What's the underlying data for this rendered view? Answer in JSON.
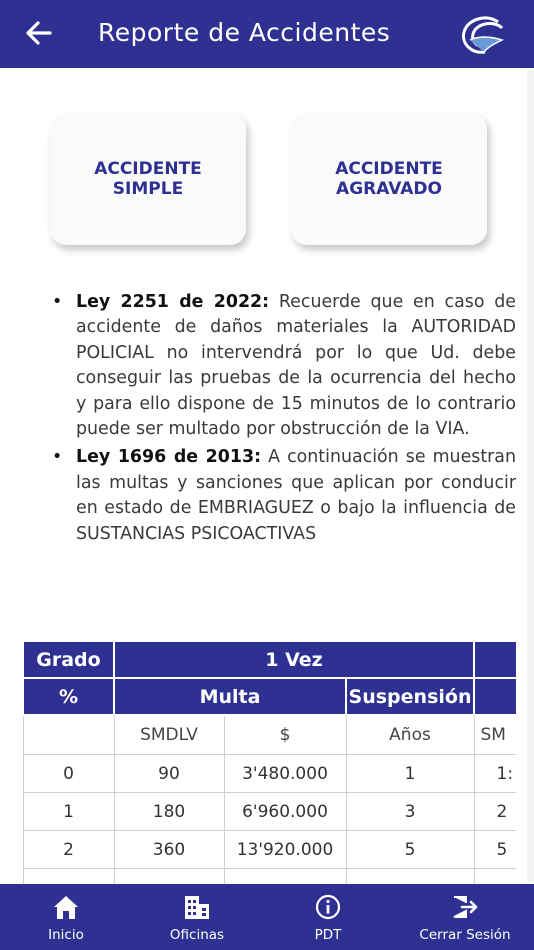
{
  "appbar": {
    "title": "Reporte de Accidentes",
    "back_icon": "arrow-left-icon",
    "logo": "brand-swirl-logo"
  },
  "cards": [
    {
      "label": "ACCIDENTE SIMPLE"
    },
    {
      "label": "ACCIDENTE AGRAVADO"
    }
  ],
  "info": [
    {
      "law": "Ley 2251 de 2022:",
      "text": " Recuerde que en caso de accidente de daños materiales la AUTORIDAD POLICIAL no intervendrá por lo que Ud. debe conseguir las pruebas de la ocurrencia del hecho y para ello dispone de 15 minutos de lo contrario puede ser multado por obstrucción de la VIA."
    },
    {
      "law": "Ley 1696 de 2013:",
      "text": " A continuación se muestran las multas y sanciones que aplican por conducir en estado de EMBRIAGUEZ o bajo la influencia de SUSTANCIAS PSICOACTIVAS"
    }
  ],
  "table": {
    "header_grado": "Grado",
    "header_vez": "1 Vez",
    "header_pct": "%",
    "header_multa": "Multa",
    "header_suspension": "Suspensión",
    "sub_smdlv": "SMDLV",
    "sub_peso": "$",
    "sub_anos": "Años",
    "sub_next": "SM",
    "rows": [
      {
        "grado": "0",
        "smdlv": "90",
        "pesos": "3'480.000",
        "anos": "1",
        "next": "1:"
      },
      {
        "grado": "1",
        "smdlv": "180",
        "pesos": "6'960.000",
        "anos": "3",
        "next": "2"
      },
      {
        "grado": "2",
        "smdlv": "360",
        "pesos": "13'920.000",
        "anos": "5",
        "next": "5"
      }
    ]
  },
  "bottom_nav": [
    {
      "label": "Inicio",
      "icon": "home-icon"
    },
    {
      "label": "Oficinas",
      "icon": "building-icon"
    },
    {
      "label": "PDT",
      "icon": "info-icon"
    },
    {
      "label": "Cerrar Sesión",
      "icon": "logout-icon"
    }
  ],
  "colors": {
    "primary": "#2e3192",
    "card_bg": "#fafafa",
    "text": "#3a3a3a"
  }
}
